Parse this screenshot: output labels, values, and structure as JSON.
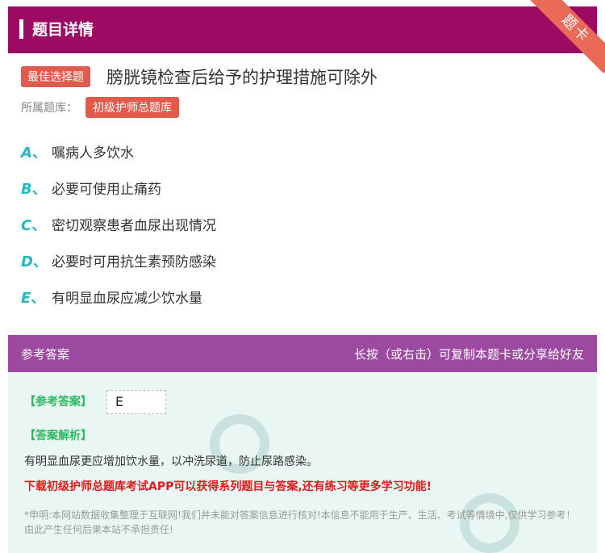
{
  "header": {
    "title": "题目详情"
  },
  "ribbon": {
    "text": "题卡"
  },
  "question": {
    "tag": "最佳选择题",
    "text": "膀胱镜检查后给予的护理措施可除外",
    "bank_label": "所属题库：",
    "bank_name": "初级护师总题库"
  },
  "options": [
    {
      "letter": "A",
      "sep": "、",
      "text": "嘱病人多饮水"
    },
    {
      "letter": "B",
      "sep": "、",
      "text": "必要可使用止痛药"
    },
    {
      "letter": "C",
      "sep": "、",
      "text": "密切观察患者血尿出现情况"
    },
    {
      "letter": "D",
      "sep": "、",
      "text": "必要时可用抗生素预防感染"
    },
    {
      "letter": "E",
      "sep": "、",
      "text": "有明显血尿应减少饮水量"
    }
  ],
  "answer_header": {
    "left": "参考答案",
    "right": "长按（或右击）可复制本题卡或分享给好友"
  },
  "answer": {
    "ref_label": "【参考答案】",
    "ref_value": "E",
    "analysis_label": "【答案解析】",
    "analysis_text": "有明显血尿更应增加饮水量，以冲洗尿道，防止尿路感染。",
    "promo": "下载初级护师总题库考试APP可以获得系列题目与答案,还有练习等更多学习功能!",
    "disclaimer": "*申明:本网站数据收集整理于互联网!我们并未能对答案信息进行核对!本信息不能用于生产、生活、考试等情境中,仅供学习参考！由此产生任何后果本站不承担责任!"
  },
  "colors": {
    "header_bg": "#9b0a63",
    "answer_header_bg": "#9b4a9f",
    "tag_bg": "#e05b4c",
    "option_letter": "#27b7c3",
    "answer_green": "#2db85f",
    "promo_red": "#e0191b"
  }
}
